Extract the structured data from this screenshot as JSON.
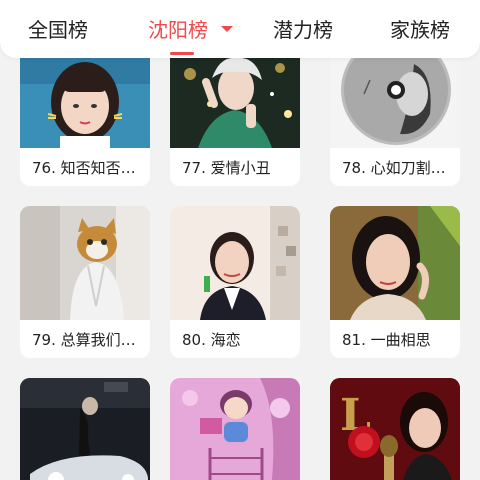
{
  "tabs": [
    {
      "label": "全国榜"
    },
    {
      "label": "沈阳榜"
    },
    {
      "label": "潜力榜"
    },
    {
      "label": "家族榜"
    }
  ],
  "active_tab": "沈阳榜",
  "accent_color": "#f0484b",
  "cards": [
    {
      "title": "76. 知否知否…"
    },
    {
      "title": "77. 爱情小丑"
    },
    {
      "title": "78. 心如刀割…"
    },
    {
      "title": "79. 总算我们…"
    },
    {
      "title": "80. 海恋"
    },
    {
      "title": "81. 一曲相思"
    },
    {
      "title": ""
    },
    {
      "title": ""
    },
    {
      "title": ""
    }
  ]
}
